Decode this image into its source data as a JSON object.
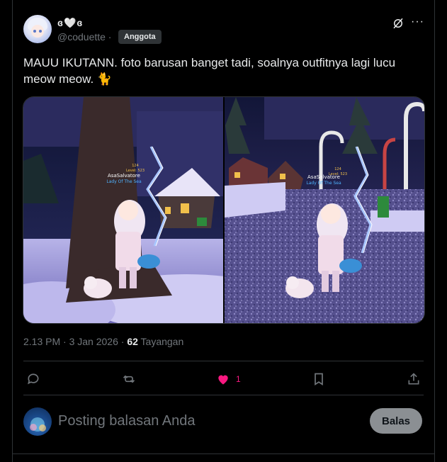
{
  "author": {
    "display_name": "ɞ🤍ɞ",
    "handle": "@coduette ·",
    "badge": "Anggota"
  },
  "tweet": {
    "text": "MAUU IKUTANN. foto barusan banget tadi, soalnya outfitnya lagi lucu meow meow. 🐈"
  },
  "media": {
    "images": [
      {
        "name_tag": {
          "level": "124",
          "level_label": "Level: 523",
          "username": "AsaSalvatore",
          "title": "Lady Of The Sea"
        }
      },
      {
        "name_tag": {
          "level": "124",
          "level_label": "Level: 523",
          "username": "AsaSalvatore",
          "title": "Lady Of The Sea"
        }
      }
    ]
  },
  "meta": {
    "time": "2.13 PM · 3 Jan 2026 ·",
    "views_count": "62",
    "views_label": "Tayangan"
  },
  "actions": {
    "like_count": "1",
    "like_color": "#f91880"
  },
  "reply": {
    "placeholder": "Posting balasan Anda",
    "button": "Balas"
  },
  "icons": [
    "grok-icon",
    "more-icon",
    "reply-icon",
    "repost-icon",
    "heart-icon",
    "bookmark-icon",
    "share-icon"
  ]
}
